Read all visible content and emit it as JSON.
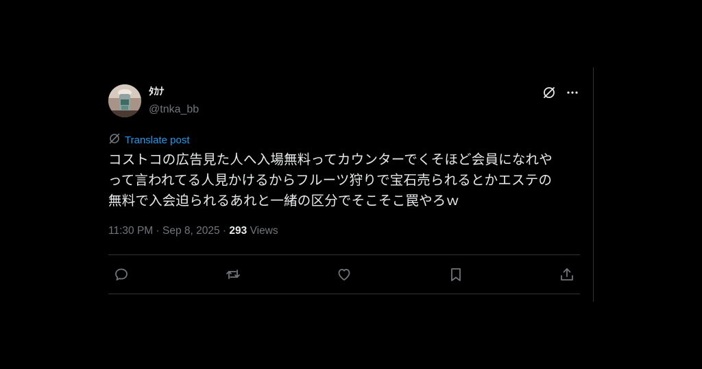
{
  "tweet": {
    "display_name": "ﾀｶﾅ",
    "handle": "@tnka_bb",
    "translate_label": "Translate post",
    "text": "コストコの広告見た人へ入場無料ってカウンターでくそほど会員になれや\nって言われてる人見かけるからフルーツ狩りで宝石売られるとかエステの\n無料で入会迫られるあれと一緒の区分でそこそこ罠やろｗ",
    "time": "11:30 PM",
    "dot": " · ",
    "date": "Sep 8, 2025",
    "views_count": "293",
    "views_label": "Views"
  },
  "icons": {
    "header": [
      "grok-icon",
      "more-icon"
    ],
    "translate": "translate-icon",
    "actions": [
      "reply-icon",
      "retweet-icon",
      "like-icon",
      "bookmark-icon",
      "share-icon"
    ]
  },
  "colors": {
    "background": "#000000",
    "text": "#e7e9ea",
    "secondary": "#71767b",
    "link": "#1d9bf0",
    "divider": "#2f3336"
  }
}
